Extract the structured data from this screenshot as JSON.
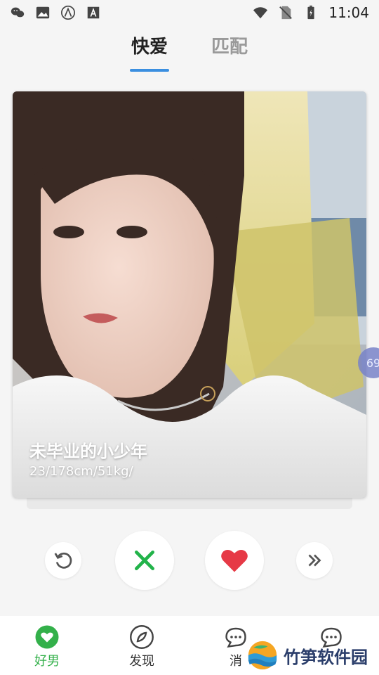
{
  "status_bar": {
    "left_icons": [
      "wechat-icon",
      "image-icon",
      "a-circle-icon",
      "a-box-icon"
    ],
    "right_icons": [
      "wifi-icon",
      "no-sim-icon",
      "battery-icon"
    ],
    "time": "11:04"
  },
  "tabs": [
    {
      "label": "快爱",
      "active": true
    },
    {
      "label": "匹配",
      "active": false
    }
  ],
  "card": {
    "name": "未毕业的小少年",
    "info": "23/178cm/51kg/",
    "count": "69"
  },
  "actions": [
    "undo-icon",
    "close-icon",
    "heart-icon",
    "fast-forward-icon"
  ],
  "bottom_nav": [
    {
      "label": "好男",
      "icon": "heart-badge-icon",
      "active": true
    },
    {
      "label": "发现",
      "icon": "compass-icon",
      "active": false
    },
    {
      "label": "消",
      "icon": "message-icon",
      "active": false
    },
    {
      "label": "",
      "icon": "message-icon",
      "active": false
    }
  ],
  "watermark": {
    "text": "竹笋软件园"
  },
  "colors": {
    "accent": "#3b8fe0",
    "nav_active": "#33b04a",
    "like": "#e63946",
    "dislike": "#22b34a"
  }
}
